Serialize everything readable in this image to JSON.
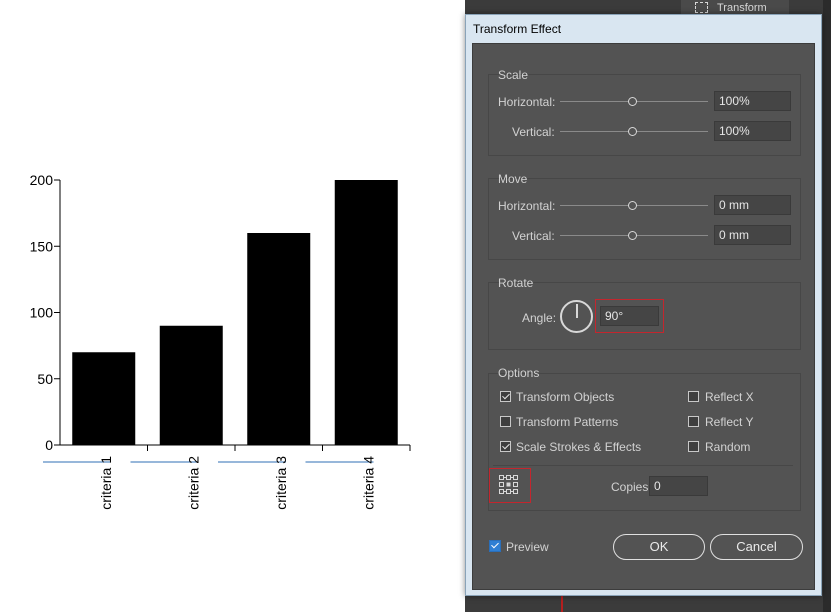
{
  "chart_data": {
    "type": "bar",
    "categories": [
      "criteria 1",
      "criteria 2",
      "criteria 3",
      "criteria 4"
    ],
    "values": [
      70,
      90,
      160,
      200
    ],
    "ylim": [
      0,
      200
    ],
    "yticks": [
      0,
      50,
      100,
      150,
      200
    ],
    "ytick_labels": [
      "0",
      "50",
      "100",
      "150",
      "200"
    ],
    "bar_color": "#000000",
    "axis_color": "#000000",
    "label_rotation_deg": 90
  },
  "app": {
    "panel_tab_label": "Transform"
  },
  "dialog": {
    "title": "Transform Effect",
    "scale": {
      "label": "Scale",
      "horizontal_label": "Horizontal:",
      "horizontal_value": "100%",
      "vertical_label": "Vertical:",
      "vertical_value": "100%"
    },
    "move": {
      "label": "Move",
      "horizontal_label": "Horizontal:",
      "horizontal_value": "0 mm",
      "vertical_label": "Vertical:",
      "vertical_value": "0 mm"
    },
    "rotate": {
      "label": "Rotate",
      "angle_label": "Angle:",
      "angle_value": "90°"
    },
    "options": {
      "label": "Options",
      "transform_objects": "Transform Objects",
      "transform_objects_checked": true,
      "transform_patterns": "Transform Patterns",
      "transform_patterns_checked": false,
      "scale_strokes": "Scale Strokes & Effects",
      "scale_strokes_checked": true,
      "reflect_x": "Reflect X",
      "reflect_x_checked": false,
      "reflect_y": "Reflect Y",
      "reflect_y_checked": false,
      "random": "Random",
      "random_checked": false,
      "copies_label": "Copies",
      "copies_value": "0"
    },
    "preview_label": "Preview",
    "preview_checked": true,
    "ok_label": "OK",
    "cancel_label": "Cancel"
  },
  "colors": {
    "dialog_bg": "#535353",
    "highlight": "#c4262e",
    "checkbox_blue": "#2f7fd4"
  }
}
